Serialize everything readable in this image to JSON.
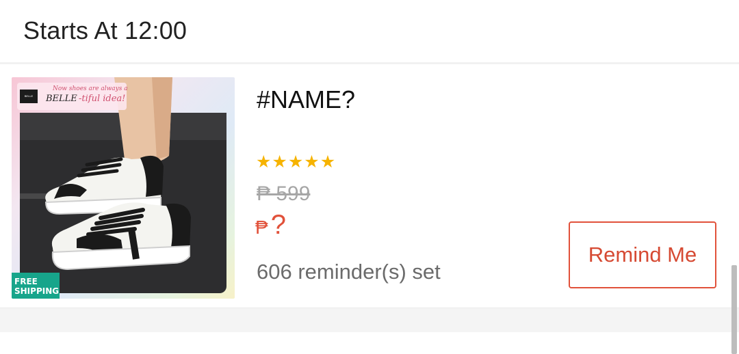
{
  "header": {
    "title": "Starts At 12:00"
  },
  "product": {
    "name": "#NAME?",
    "rating_stars": 5,
    "original_price": "₱ 599",
    "price_currency": "₱",
    "price_value": "?",
    "reminders": "606 reminder(s) set",
    "remind_label": "Remind Me",
    "image": {
      "promo_line": "Now shoes are always a",
      "brand_text": "BELLE",
      "brand_tail": "-tiful idea!",
      "badge_line1": "FREE",
      "badge_line2": "SHIPPING"
    }
  },
  "colors": {
    "accent": "#e1513a",
    "star": "#f6b300",
    "badge": "#17a58b"
  }
}
